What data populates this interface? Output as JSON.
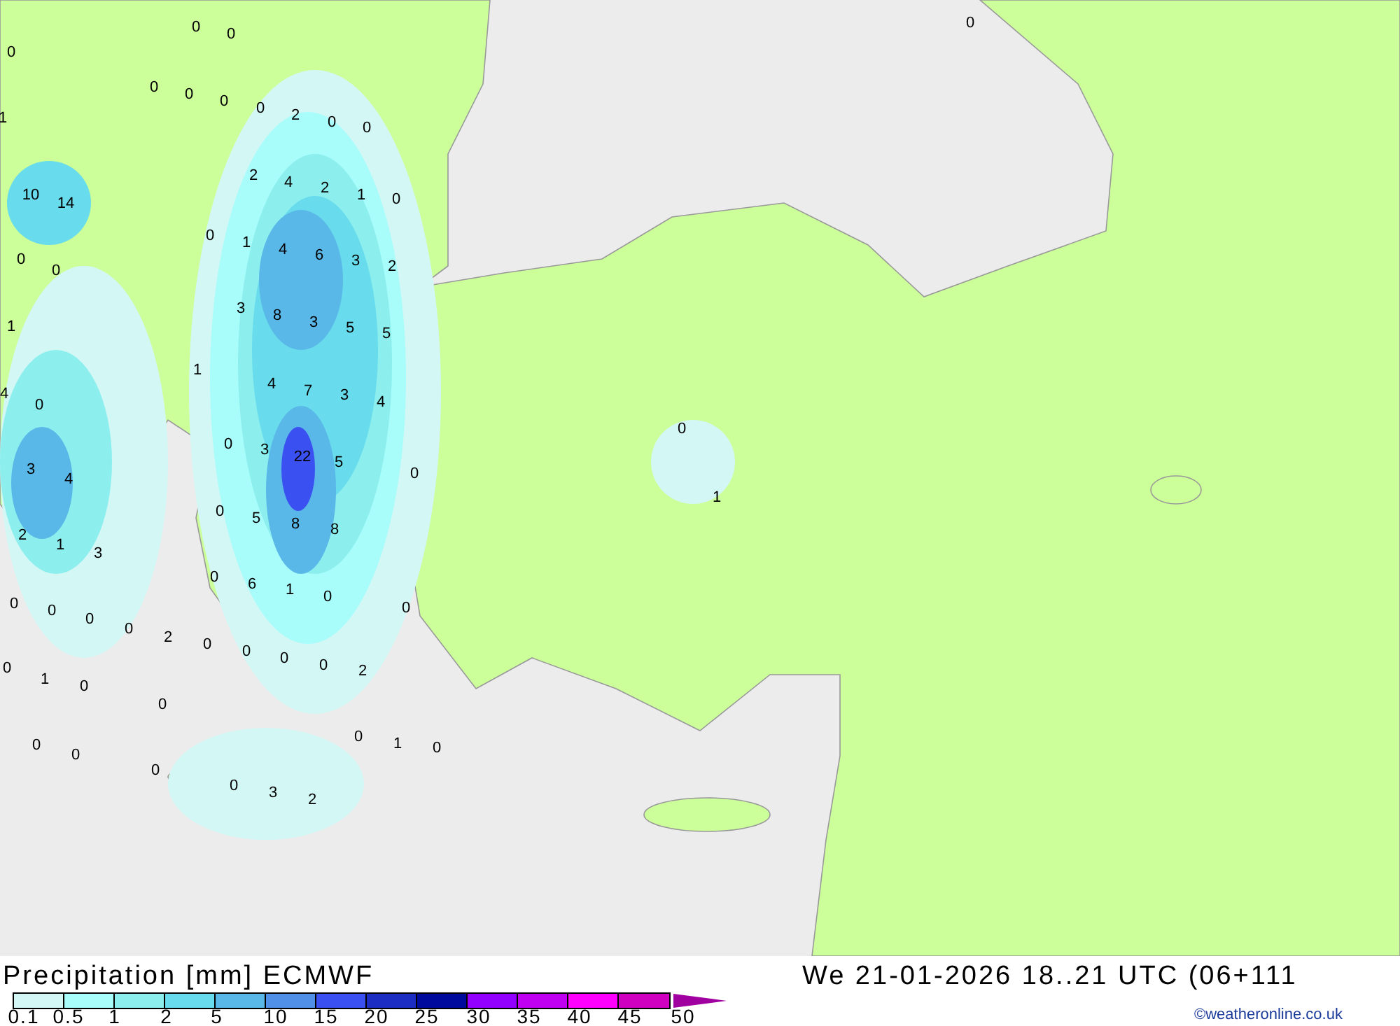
{
  "map_values": [
    "0",
    "0",
    "0",
    "0",
    "1",
    "0",
    "0",
    "0",
    "0",
    "2",
    "0",
    "0",
    "10",
    "14",
    "2",
    "4",
    "2",
    "1",
    "0",
    "0",
    "0",
    "0",
    "1",
    "4",
    "6",
    "3",
    "2",
    "1",
    "3",
    "8",
    "3",
    "5",
    "5",
    "1",
    "4",
    "0",
    "4",
    "7",
    "3",
    "4",
    "0",
    "3",
    "4",
    "0",
    "3",
    "22",
    "5",
    "0",
    "1",
    "2",
    "1",
    "3",
    "0",
    "5",
    "8",
    "8",
    "0",
    "0",
    "1",
    "0",
    "0",
    "0",
    "0",
    "2",
    "0",
    "0",
    "0",
    "6",
    "0",
    "1",
    "0",
    "0",
    "2",
    "0",
    "0",
    "0",
    "0",
    "0",
    "1",
    "0",
    "0",
    "0",
    "3",
    "2"
  ],
  "legend": {
    "title": "Precipitation [mm] ECMWF",
    "bins": [
      {
        "color": "#d2f7f5"
      },
      {
        "color": "#a8fdfb"
      },
      {
        "color": "#8cefee"
      },
      {
        "color": "#68dcec"
      },
      {
        "color": "#5ab8e8"
      },
      {
        "color": "#5090e8"
      },
      {
        "color": "#3b50f0"
      },
      {
        "color": "#1c2dc4"
      },
      {
        "color": "#000b9e"
      },
      {
        "color": "#9400ff"
      },
      {
        "color": "#c000f0"
      },
      {
        "color": "#ff00ff"
      },
      {
        "color": "#d000c0"
      }
    ],
    "labels": [
      "0.1",
      "0.5",
      "1",
      "2",
      "5",
      "10",
      "15",
      "20",
      "25",
      "30",
      "35",
      "40",
      "45",
      "50"
    ]
  },
  "valid_time": "We 21-01-2026 18..21 UTC (06+111",
  "credit": "©weatheronline.co.uk"
}
